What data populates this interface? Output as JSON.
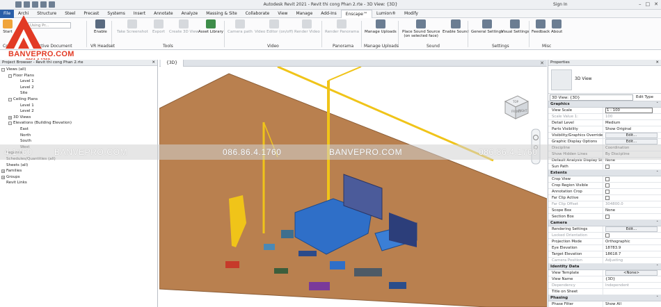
{
  "app": {
    "title": "Autodesk Revit 2021 - Revit thi cong Phan 2.rte - 3D View: {3D}",
    "sign_in": "Sign In"
  },
  "tabs": [
    "File",
    "Archi",
    "Structure",
    "Steel",
    "Precast",
    "Systems",
    "Insert",
    "Annotate",
    "Analyze",
    "Massing & Site",
    "Collaborate",
    "View",
    "Manage",
    "Add-Ins",
    "Enscape™",
    "Lumion®",
    "Modify"
  ],
  "active_tab": "Enscape™",
  "ribbon": {
    "tools": [
      {
        "label": "Start",
        "enabled": true
      },
      {
        "label": "Enable",
        "enabled": true
      },
      {
        "label": "Take Screenshot",
        "enabled": false
      },
      {
        "label": "Export",
        "enabled": false
      },
      {
        "label": "Create 3D View",
        "enabled": false
      },
      {
        "label": "Asset Library",
        "enabled": true
      },
      {
        "label": "Camera path",
        "enabled": false
      },
      {
        "label": "Video Editor (on/off)",
        "enabled": false
      },
      {
        "label": "Render Video",
        "enabled": false
      },
      {
        "label": "Render Panorama",
        "enabled": false
      },
      {
        "label": "Manage Uploads",
        "enabled": true
      },
      {
        "label": "Place Sound Source",
        "sub": "(on selected face)",
        "enabled": true
      },
      {
        "label": "Enable Sound",
        "enabled": true
      },
      {
        "label": "General Settings",
        "enabled": true
      },
      {
        "label": "Visual Settings",
        "enabled": true
      },
      {
        "label": "Feedback",
        "enabled": true
      },
      {
        "label": "About",
        "enabled": true
      }
    ],
    "groups": [
      "Control",
      "Active Document",
      "VR Headset",
      "Tools",
      "Video",
      "Panorama",
      "Manage Uploads",
      "Sound",
      "Settings",
      "Misc"
    ],
    "doc_field": "Using Pr..."
  },
  "logo": {
    "text": "BANVEPRO.COM",
    "phone": "0964.4.1760"
  },
  "project_browser": {
    "title": "Project Browser - Revit thi cong Phan 2.rte",
    "nodes": [
      {
        "label": "Views (all)",
        "level": 0,
        "toggle": "-"
      },
      {
        "label": "Floor Plans",
        "level": 1,
        "toggle": "-"
      },
      {
        "label": "Level 1",
        "level": 2
      },
      {
        "label": "Level 2",
        "level": 2
      },
      {
        "label": "Site",
        "level": 2
      },
      {
        "label": "Ceiling Plans",
        "level": 1,
        "toggle": "-"
      },
      {
        "label": "Level 1",
        "level": 2
      },
      {
        "label": "Level 2",
        "level": 2
      },
      {
        "label": "3D Views",
        "level": 1,
        "toggle": "+"
      },
      {
        "label": "Elevations (Building Elevation)",
        "level": 1,
        "toggle": "-"
      },
      {
        "label": "East",
        "level": 2
      },
      {
        "label": "North",
        "level": 2
      },
      {
        "label": "South",
        "level": 2
      },
      {
        "label": "West",
        "level": 2
      },
      {
        "label": "Legends",
        "level": 0,
        "toggle": ""
      },
      {
        "label": "Schedules/Quantities (all)",
        "level": 0,
        "toggle": ""
      },
      {
        "label": "Sheets (all)",
        "level": 0,
        "toggle": ""
      },
      {
        "label": "Families",
        "level": 0,
        "toggle": "+"
      },
      {
        "label": "Groups",
        "level": 0,
        "toggle": "+"
      },
      {
        "label": "Revit Links",
        "level": 0,
        "toggle": ""
      }
    ]
  },
  "view": {
    "tab": "{3D}",
    "viewcube": {
      "top": "TOP",
      "front": "FRONT",
      "right": "RIGHT"
    }
  },
  "properties": {
    "title": "Properties",
    "type_name": "3D View",
    "selector": "3D View: {3D}",
    "edit_type": "Edit Type",
    "sections": [
      {
        "name": "Graphics",
        "rows": [
          {
            "k": "View Scale",
            "v": "1 : 100",
            "kind": "input"
          },
          {
            "k": "Scale Value    1:",
            "v": "100",
            "dim": true
          },
          {
            "k": "Detail Level",
            "v": "Medium"
          },
          {
            "k": "Parts Visibility",
            "v": "Show Original"
          },
          {
            "k": "Visibility/Graphics Overrides",
            "v": "Edit...",
            "kind": "btn"
          },
          {
            "k": "Graphic Display Options",
            "v": "Edit...",
            "kind": "btn"
          },
          {
            "k": "Discipline",
            "v": "Coordination"
          },
          {
            "k": "Show Hidden Lines",
            "v": "By Discipline"
          },
          {
            "k": "Default Analysis Display St...",
            "v": "None"
          },
          {
            "k": "Sun Path",
            "v": "",
            "kind": "check"
          }
        ]
      },
      {
        "name": "Extents",
        "rows": [
          {
            "k": "Crop View",
            "v": "",
            "kind": "check"
          },
          {
            "k": "Crop Region Visible",
            "v": "",
            "kind": "check"
          },
          {
            "k": "Annotation Crop",
            "v": "",
            "kind": "check"
          },
          {
            "k": "Far Clip Active",
            "v": "",
            "kind": "check"
          },
          {
            "k": "Far Clip Offset",
            "v": "304800.0",
            "dim": true
          },
          {
            "k": "Scope Box",
            "v": "None"
          },
          {
            "k": "Section Box",
            "v": "",
            "kind": "check"
          }
        ]
      },
      {
        "name": "Camera",
        "rows": [
          {
            "k": "Rendering Settings",
            "v": "Edit...",
            "kind": "btn"
          },
          {
            "k": "Locked Orientation",
            "v": "",
            "kind": "check",
            "dim": true
          },
          {
            "k": "Projection Mode",
            "v": "Orthographic"
          },
          {
            "k": "Eye Elevation",
            "v": "18783.9"
          },
          {
            "k": "Target Elevation",
            "v": "18618.7"
          },
          {
            "k": "Camera Position",
            "v": "Adjusting",
            "dim": true
          }
        ]
      },
      {
        "name": "Identity Data",
        "rows": [
          {
            "k": "View Template",
            "v": "<None>",
            "kind": "btn"
          },
          {
            "k": "View Name",
            "v": "{3D}"
          },
          {
            "k": "Dependency",
            "v": "Independent",
            "dim": true
          },
          {
            "k": "Title on Sheet",
            "v": ""
          }
        ]
      },
      {
        "name": "Phasing",
        "rows": [
          {
            "k": "Phase Filter",
            "v": "Show All"
          },
          {
            "k": "Phase",
            "v": "Phase 1"
          }
        ]
      }
    ]
  },
  "watermark": [
    "4.1760",
    "BANVEPRO.COM",
    "086.86.4.1760",
    "BANVEPRO.COM",
    "086.86.4.1760"
  ],
  "colors": {
    "ground": "#b9804f",
    "crane": "#f0c419",
    "roof_blue": "#2f6fc8",
    "file_tab": "#2a5ea8",
    "logo_red": "#e23a24"
  }
}
